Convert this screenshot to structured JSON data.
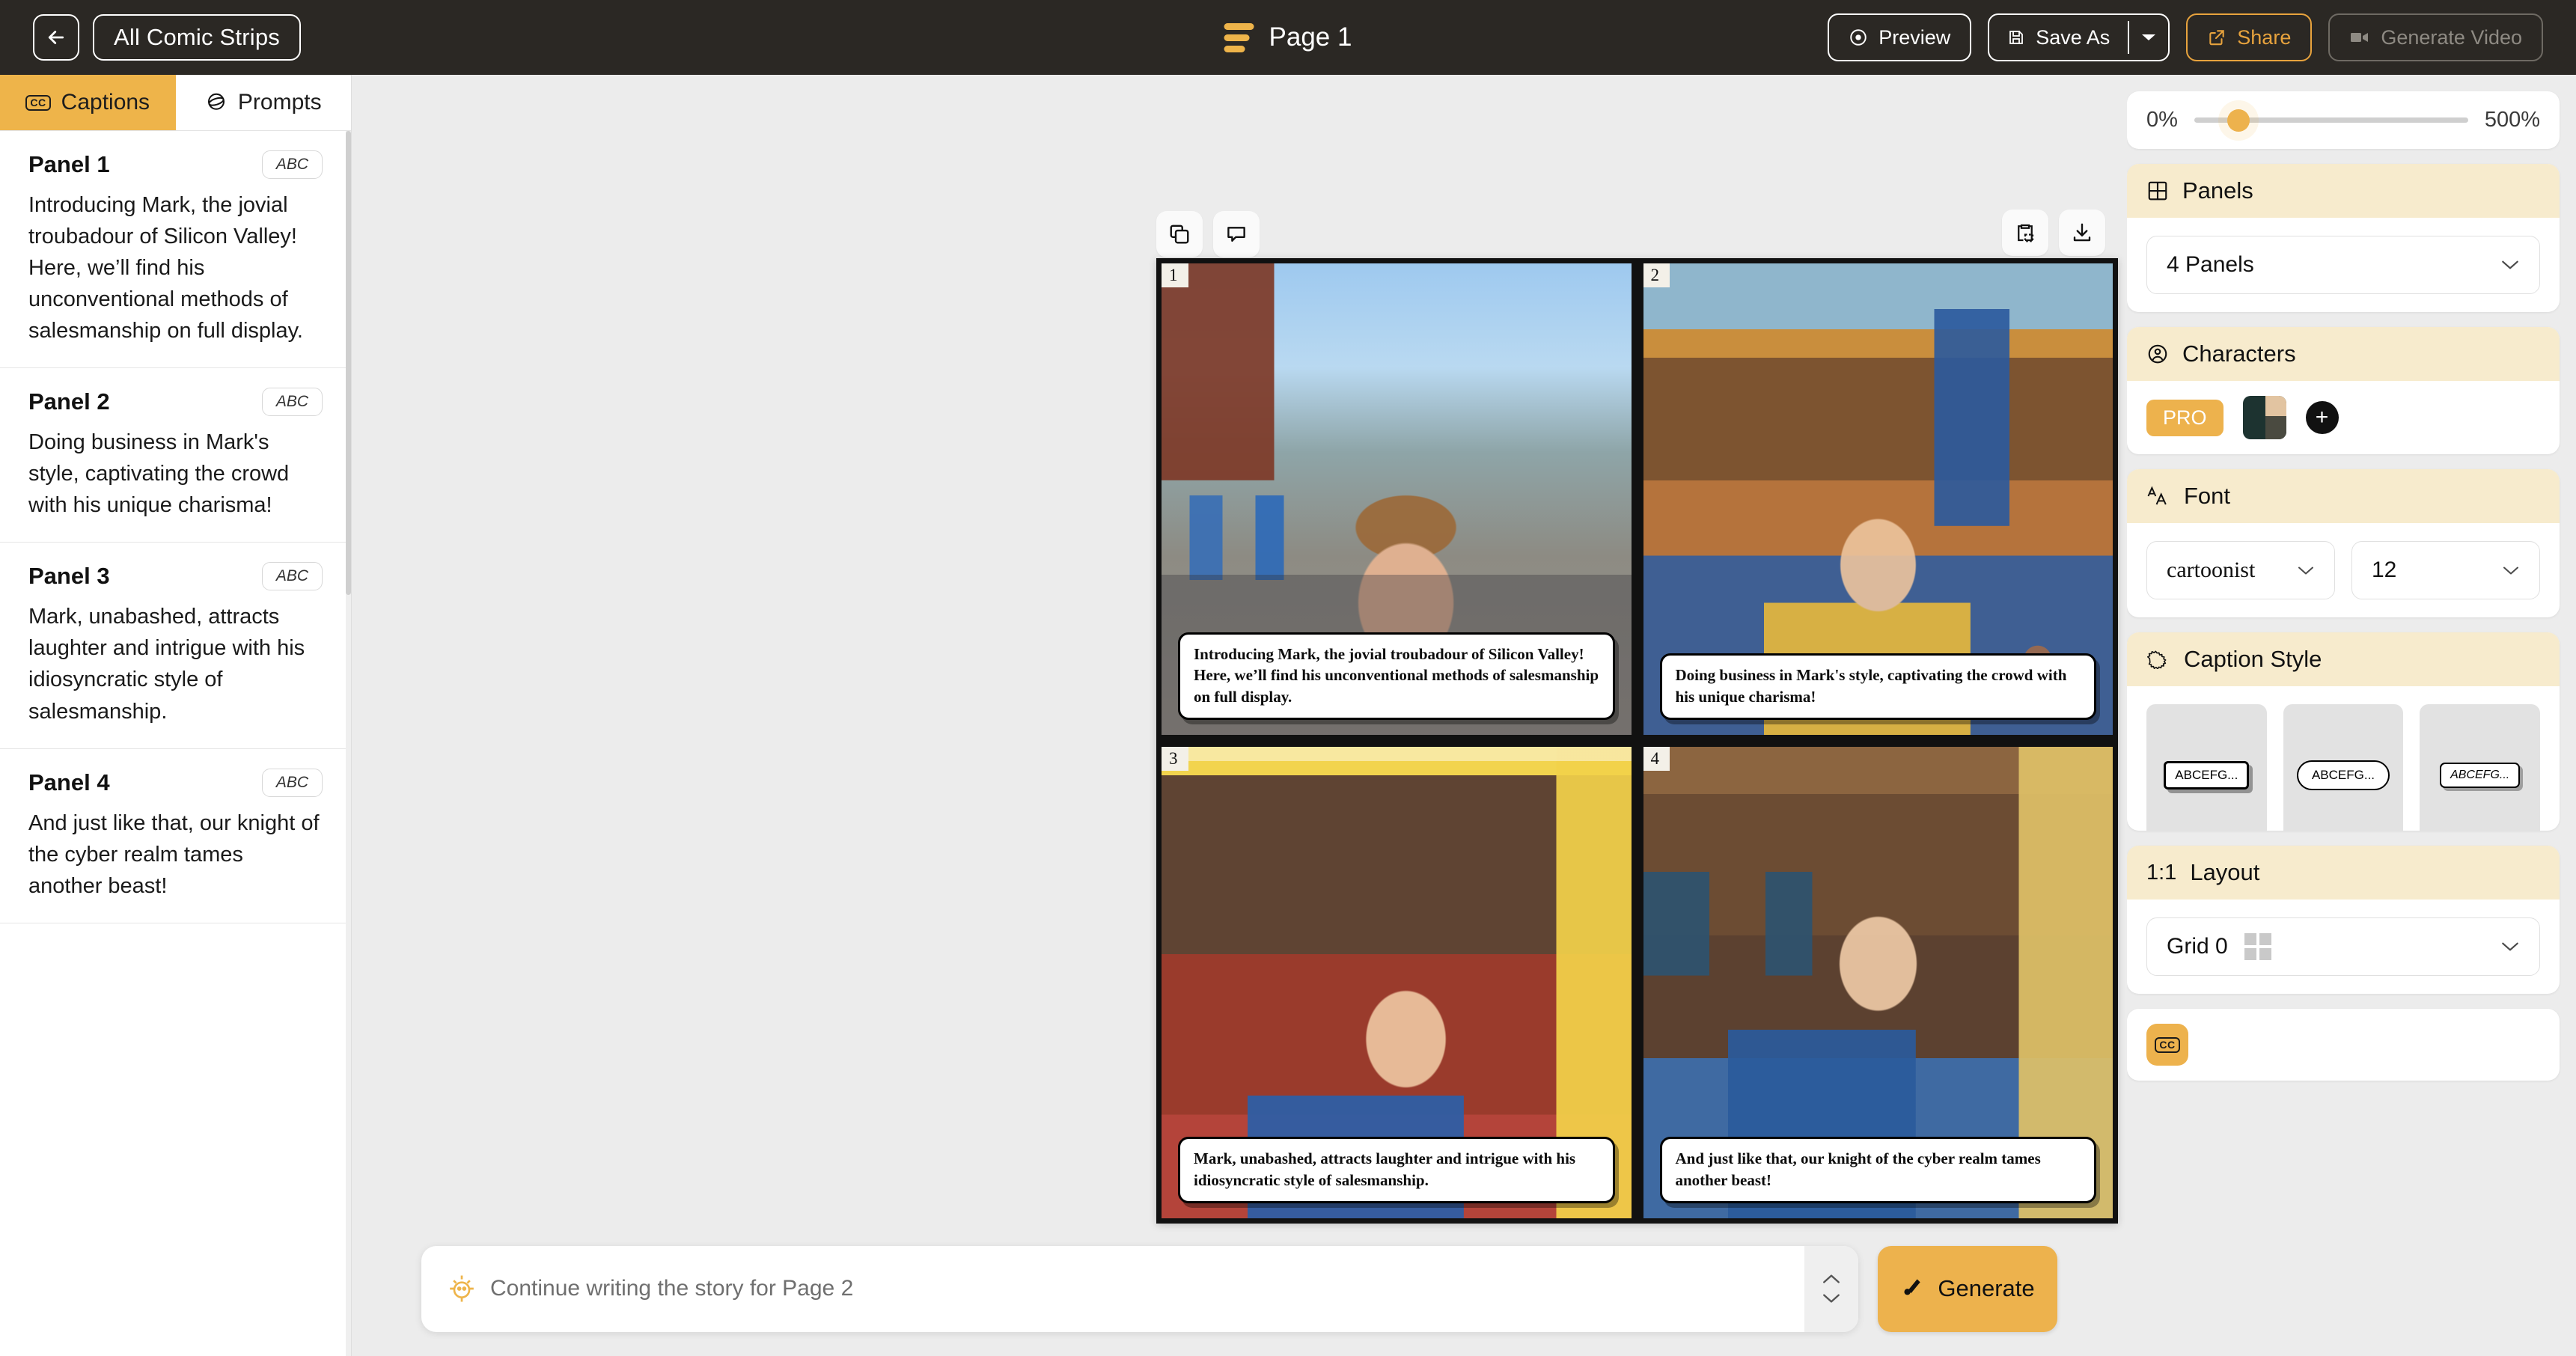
{
  "topbar": {
    "back_icon": "arrow-left-icon",
    "all_strips_label": "All Comic Strips",
    "page_title": "Page 1",
    "preview_label": "Preview",
    "save_as_label": "Save As",
    "share_label": "Share",
    "generate_video_label": "Generate Video",
    "accent_color": "#e8a33d",
    "bar_color": "#2b2824"
  },
  "left": {
    "tabs": [
      {
        "label": "Captions",
        "icon": "cc-icon",
        "active": true
      },
      {
        "label": "Prompts",
        "icon": "sphere-icon",
        "active": false
      }
    ],
    "panels": [
      {
        "title": "Panel 1",
        "chip": "ABC",
        "text": "Introducing Mark, the jovial troubadour of Silicon Valley! Here, we’ll find his unconventional methods of salesmanship on full display."
      },
      {
        "title": "Panel 2",
        "chip": "ABC",
        "text": "Doing business in Mark's style, captivating the crowd with his unique charisma!"
      },
      {
        "title": "Panel 3",
        "chip": "ABC",
        "text": "Mark, unabashed, attracts laughter and intrigue with his idiosyncratic style of salesmanship."
      },
      {
        "title": "Panel 4",
        "chip": "ABC",
        "text": "And just like that, our knight of the cyber realm tames another beast!"
      }
    ]
  },
  "canvas": {
    "toolbar_left": [
      {
        "name": "duplicate-icon"
      },
      {
        "name": "speech-bubble-icon"
      }
    ],
    "toolbar_right": [
      {
        "name": "clipboard-icon"
      },
      {
        "name": "download-icon"
      }
    ],
    "comic_panels": [
      {
        "number": "1",
        "caption": "Introducing Mark, the jovial troubadour of Silicon Valley! Here, we’ll find his unconventional methods of salesmanship on full display."
      },
      {
        "number": "2",
        "caption": "Doing business in Mark's style, captivating the crowd with his unique charisma!"
      },
      {
        "number": "3",
        "caption": "Mark, unabashed, attracts laughter and intrigue with his idiosyncratic style of salesmanship."
      },
      {
        "number": "4",
        "caption": "And just like that, our knight of the cyber realm tames another beast!"
      }
    ]
  },
  "prompt": {
    "placeholder": "Continue writing the story for Page 2",
    "value": "",
    "generate_label": "Generate",
    "generate_color": "#edb24d"
  },
  "right": {
    "zoom": {
      "min_label": "0%",
      "max_label": "500%",
      "thumb_percent": 12
    },
    "panels_section": {
      "title": "Panels",
      "icon": "grid-icon",
      "selected": "4 Panels"
    },
    "characters_section": {
      "title": "Characters",
      "icon": "user-circle-icon",
      "pro_badge": "PRO",
      "add_label": "+"
    },
    "font_section": {
      "title": "Font",
      "icon": "font-size-icon",
      "family": "cartoonist",
      "size": "12"
    },
    "caption_style_section": {
      "title": "Caption Style",
      "icon": "burst-bubble-icon",
      "swatches": [
        "ABCEFG...",
        "ABCEFG...",
        "ABCEFG..."
      ]
    },
    "layout_section": {
      "title": "Layout",
      "ratio": "1:1",
      "selected": "Grid 0"
    },
    "cc_button": {
      "icon": "cc-icon",
      "color": "#edb24d"
    }
  }
}
